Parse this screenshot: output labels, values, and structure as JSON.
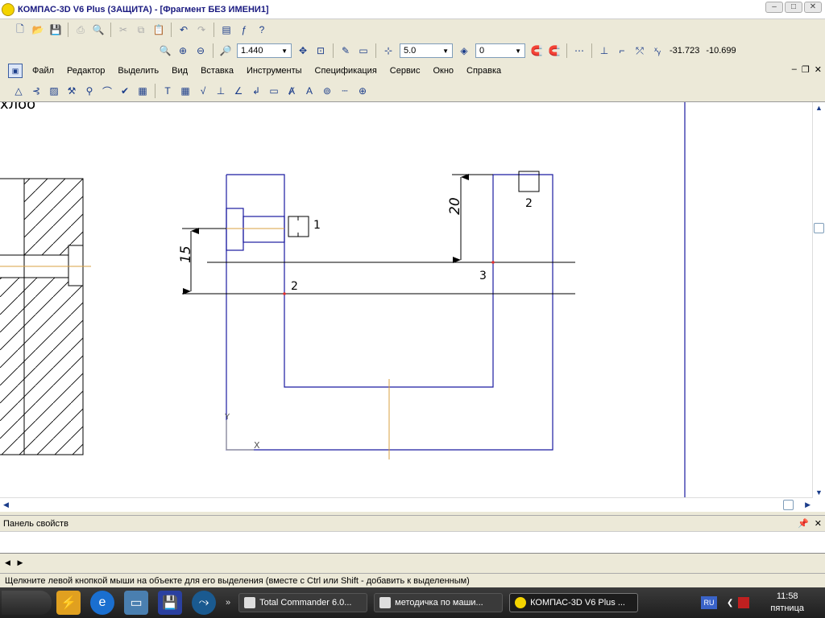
{
  "window": {
    "title": "КОМПАС-3D V6 Plus (ЗАЩИТА) - [Фрагмент БЕЗ ИМЕНИ1]"
  },
  "toolbar2": {
    "zoom_value": "1.440",
    "step_value": "5.0",
    "layer_value": "0",
    "coord_x": "-31.723",
    "coord_y": "-10.699"
  },
  "menu": {
    "items": [
      "Файл",
      "Редактор",
      "Выделить",
      "Вид",
      "Вставка",
      "Инструменты",
      "Спецификация",
      "Сервис",
      "Окно",
      "Справка"
    ]
  },
  "drawing": {
    "corner_text": "хлоо",
    "dim_20": "20",
    "dim_15": "15",
    "label_1": "1",
    "label_2a": "2",
    "label_2b": "2",
    "label_3": "3",
    "axis_x": "X",
    "axis_y": "Y",
    "colors": {
      "blue": "#1a1aa0",
      "black": "#000000",
      "orange": "#d9a040",
      "red": "#e03030"
    }
  },
  "panel": {
    "title": "Панель свойств"
  },
  "status": {
    "text": "Щелкните левой кнопкой мыши на объекте для его выделения (вместе с Ctrl или Shift - добавить к выделенным)"
  },
  "taskbar": {
    "tasks": [
      "Total Commander 6.0...",
      "методичка по маши...",
      "КОМПАС-3D V6 Plus ..."
    ],
    "lang": "RU",
    "time": "11:58",
    "day": "пятница"
  }
}
